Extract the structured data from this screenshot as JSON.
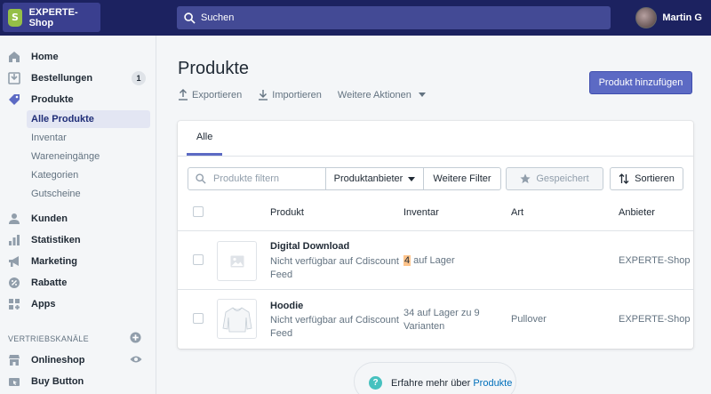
{
  "topbar": {
    "shop_name": "EXPERTE-Shop",
    "search_placeholder": "Suchen",
    "user_name": "Martin G"
  },
  "sidebar": {
    "items": [
      {
        "label": "Home",
        "icon": "home-icon"
      },
      {
        "label": "Bestellungen",
        "icon": "orders-icon",
        "badge": "1"
      },
      {
        "label": "Produkte",
        "icon": "tag-icon"
      },
      {
        "label": "Kunden",
        "icon": "customers-icon"
      },
      {
        "label": "Statistiken",
        "icon": "bar-chart-icon"
      },
      {
        "label": "Marketing",
        "icon": "megaphone-icon"
      },
      {
        "label": "Rabatte",
        "icon": "discount-icon"
      },
      {
        "label": "Apps",
        "icon": "apps-icon"
      }
    ],
    "sub_items": [
      "Alle Produkte",
      "Inventar",
      "Wareneingänge",
      "Kategorien",
      "Gutscheine"
    ],
    "section_label": "VERTRIEBSKANÄLE",
    "channels": [
      {
        "label": "Onlineshop",
        "icon": "store-icon"
      },
      {
        "label": "Buy Button",
        "icon": "buy-button-icon"
      }
    ]
  },
  "main": {
    "title": "Produkte",
    "actions": [
      "Exportieren",
      "Importieren",
      "Weitere Aktionen"
    ],
    "primary_button": "Produkt hinzufügen",
    "tab": "Alle",
    "filter": {
      "placeholder": "Produkte filtern",
      "vendor": "Produktanbieter",
      "more": "Weitere Filter",
      "saved": "Gespeichert",
      "sort": "Sortieren"
    },
    "columns": [
      "Produkt",
      "Inventar",
      "Art",
      "Anbieter"
    ],
    "products": [
      {
        "name": "Digital Download",
        "note": "Nicht verfügbar auf Cdiscount Feed",
        "inventory_count": "4",
        "inventory_text": " auf Lager",
        "type": "",
        "vendor": "EXPERTE-Shop"
      },
      {
        "name": "Hoodie",
        "note": "Nicht verfügbar auf Cdiscount Feed",
        "inventory_text": "34 auf Lager zu 9 Varianten",
        "type": "Pullover",
        "vendor": "EXPERTE-Shop"
      }
    ],
    "help": {
      "prefix": "Erfahre mehr über ",
      "link": "Produkte"
    }
  },
  "colors": {
    "topbar": "#1c2260",
    "primary": "#5c6ac4",
    "highlight": "#ffc48b",
    "help": "#47c1bf"
  }
}
